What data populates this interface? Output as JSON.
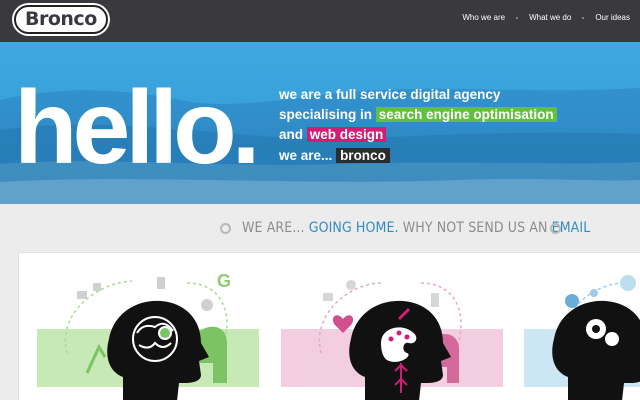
{
  "header": {
    "logo_text": "Bronco",
    "nav": [
      {
        "label": "Who we are"
      },
      {
        "label": "What we do"
      },
      {
        "label": "Our ideas"
      }
    ]
  },
  "hero": {
    "headline": "hello.",
    "tagline_line1": "we are a full service digital agency",
    "tagline_line2_prefix": "specialising in",
    "tagline_highlight_green": "search engine optimisation",
    "tagline_line3_prefix": "and",
    "tagline_highlight_pink": "web design",
    "weare_prefix": "we are...",
    "weare_highlight": "bronco"
  },
  "strip": {
    "text_prefix": "WE ARE...",
    "link1": "GOING HOME.",
    "text_middle": "WHY NOT SEND US AN",
    "link2": "EMAIL"
  },
  "colors": {
    "green": "#61c13e",
    "pink": "#d11d74",
    "blue_link": "#2f8dc6",
    "panel_green": "#c6e9b6",
    "panel_pink": "#f3cde0",
    "panel_blue": "#cde6f4"
  },
  "panels": [
    {
      "name": "seo",
      "icon": "brain-magnifier-icon"
    },
    {
      "name": "design",
      "icon": "paint-palette-icon"
    },
    {
      "name": "ideas",
      "icon": "gears-icon"
    }
  ]
}
